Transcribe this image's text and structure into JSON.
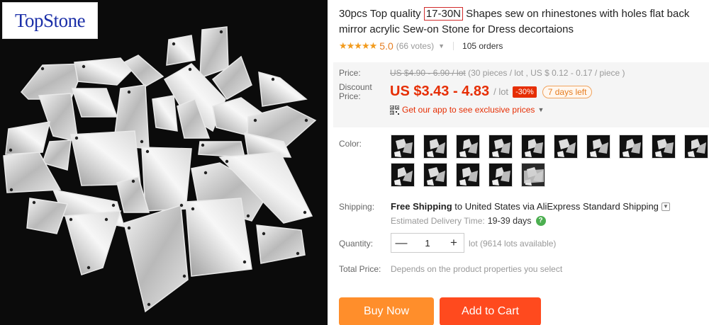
{
  "brand": {
    "logo_text": "TopStone"
  },
  "product": {
    "title_pre": "30pcs Top quality ",
    "title_highlight": "17-30N",
    "title_post": " Shapes sew on rhinestones with holes flat back mirror acrylic Sew-on Stone for Dress decortaions"
  },
  "rating": {
    "stars": "★★★★★",
    "score": "5.0",
    "votes": "(66 votes)",
    "orders": "105 orders"
  },
  "price": {
    "label": "Price:",
    "old_value": "US $4.90 - 6.90 / lot",
    "old_detail": " (30 pieces / lot , US $ 0.12 - 0.17 / piece )",
    "discount_label_line1": "Discount",
    "discount_label_line2": "Price:",
    "new_value": "US $3.43 - 4.83",
    "unit": "/ lot",
    "discount_badge": "-30%",
    "days_left": "7 days left",
    "app_promo": "Get our app to see exclusive prices"
  },
  "color": {
    "label": "Color:",
    "option_count_row1": 10,
    "option_count_row2": 5
  },
  "shipping": {
    "label": "Shipping:",
    "bold_text": "Free Shipping",
    "to_text": " to United States via AliExpress Standard Shipping",
    "delivery_label": "Estimated Delivery Time:",
    "delivery_days": "19-39 days"
  },
  "quantity": {
    "label": "Quantity:",
    "minus": "—",
    "value": "1",
    "plus": "+",
    "available": "lot (9614 lots available)"
  },
  "total": {
    "label": "Total Price:",
    "note": "Depends on the product properties you select"
  },
  "actions": {
    "buy_now": "Buy Now",
    "add_to_cart": "Add to Cart"
  },
  "colors": {
    "price_red": "#e62e04",
    "star_orange": "#f29b1d",
    "buy_orange": "#ff8e2b",
    "cart_red": "#ff4a1e"
  },
  "icons": {
    "qr": "qr-code-icon",
    "help": "question-help-icon",
    "dropdown": "chevron-down-icon"
  }
}
